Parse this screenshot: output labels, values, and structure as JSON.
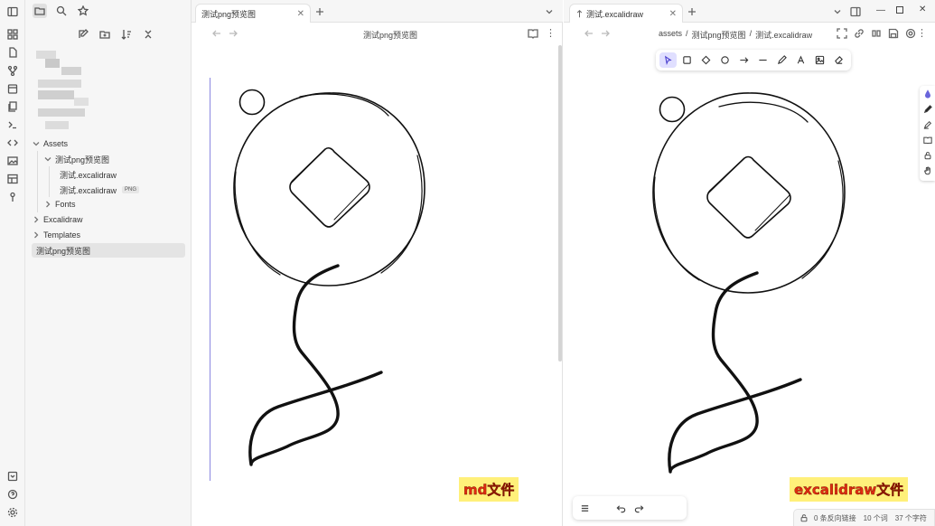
{
  "ribbon": {
    "icons": [
      "sidebar-toggle-icon",
      "graph-icon",
      "file-icon",
      "branch-icon",
      "calendar-icon",
      "copy-icon",
      "terminal-icon",
      "code-icon",
      "image-icon",
      "table-icon",
      "key-icon",
      "help-icon",
      "settings-icon"
    ]
  },
  "sidebar": {
    "tree": {
      "assets": "Assets",
      "preview_folder": "测试png预览图",
      "file_excalidraw": "测试.excalidraw",
      "file_excalidraw_png": "测试.excalidraw",
      "png_badge": "PNG",
      "fonts": "Fonts",
      "excalidraw": "Excalidraw",
      "templates": "Templates",
      "active_note": "测试png预览图"
    }
  },
  "left_pane": {
    "tab_title": "测试png预览图",
    "header_title": "测试png预览图",
    "tag": "md文件"
  },
  "right_pane": {
    "tab_title": "测试.excalidraw",
    "breadcrumb": [
      "assets",
      "/",
      "测试png预览图",
      "/",
      "测试.excalidraw"
    ],
    "tag": "excalidraw文件"
  },
  "status": {
    "backlinks": "0 条反向链接",
    "words": "10 个词",
    "chars": "37 个字符"
  },
  "colors": {
    "accent": "#6965db",
    "tag_bg": "#fff07a",
    "tag_text": "#e02b10",
    "line_guide": "#8b88e0"
  }
}
